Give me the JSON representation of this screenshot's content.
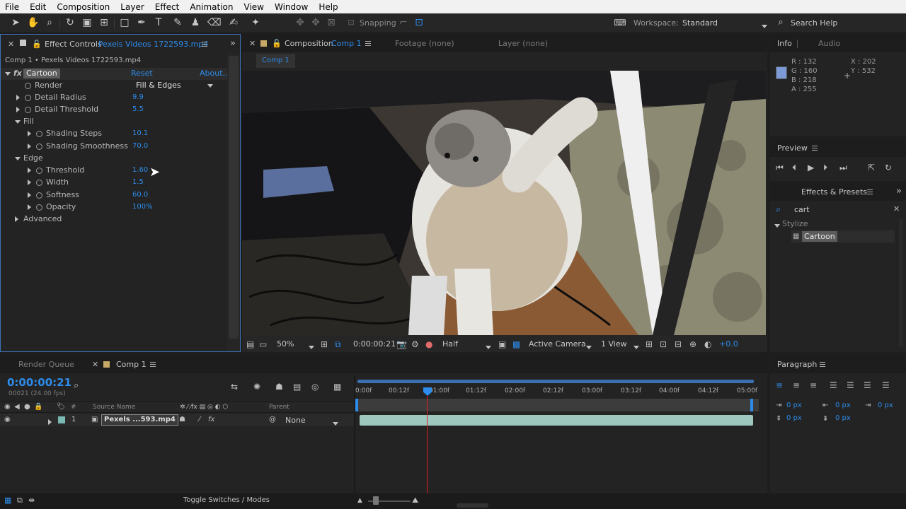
{
  "menu": [
    "File",
    "Edit",
    "Composition",
    "Layer",
    "Effect",
    "Animation",
    "View",
    "Window",
    "Help"
  ],
  "toolbar": {
    "snapping": "Snapping",
    "workspace_label": "Workspace:",
    "workspace_value": "Standard",
    "search_help": "Search Help"
  },
  "effect_controls": {
    "tab_label": "Effect Controls",
    "tab_file": "Pexels Videos 1722593.mp4",
    "header": "Comp 1 • Pexels Videos 1722593.mp4",
    "effect_name": "Cartoon",
    "reset": "Reset",
    "about": "About...",
    "render": {
      "label": "Render",
      "value": "Fill & Edges"
    },
    "detail_radius": {
      "label": "Detail Radius",
      "value": "9.9"
    },
    "detail_threshold": {
      "label": "Detail Threshold",
      "value": "5.5"
    },
    "fill": {
      "label": "Fill"
    },
    "shading_steps": {
      "label": "Shading Steps",
      "value": "10.1"
    },
    "shading_smoothness": {
      "label": "Shading Smoothness",
      "value": "70.0"
    },
    "edge": {
      "label": "Edge"
    },
    "threshold": {
      "label": "Threshold",
      "value": "1.60"
    },
    "width": {
      "label": "Width",
      "value": "1.5"
    },
    "softness": {
      "label": "Softness",
      "value": "60.0"
    },
    "opacity": {
      "label": "Opacity",
      "value": "100%"
    },
    "advanced": {
      "label": "Advanced"
    }
  },
  "composition": {
    "tab_label": "Composition",
    "tab_comp": "Comp 1",
    "footage": "Footage (none)",
    "layer": "Layer (none)",
    "crumb": "Comp 1",
    "zoom": "50%",
    "timecode": "0:00:00:21",
    "resolution": "Half",
    "camera": "Active Camera",
    "views": "1 View",
    "exposure": "+0.0"
  },
  "info": {
    "tab": "Info",
    "audio": "Audio",
    "r": "R : 132",
    "g": "G : 160",
    "b": "B : 218",
    "a": "A : 255",
    "x": "X : 202",
    "y": "Y : 532",
    "swatch": "#7b9ad6"
  },
  "preview": {
    "tab": "Preview"
  },
  "effects_presets": {
    "tab": "Effects & Presets",
    "search": "cart",
    "category": "Stylize",
    "item": "Cartoon"
  },
  "timeline": {
    "render_queue": "Render Queue",
    "comp_tab": "Comp 1",
    "timecode": "0:00:00:21",
    "fps": "00021 (24.00 fps)",
    "col_num": "#",
    "col_source": "Source Name",
    "col_parent": "Parent",
    "ruler": [
      "0:00f",
      "00:12f",
      "01:00f",
      "01:12f",
      "02:00f",
      "02:12f",
      "03:00f",
      "03:12f",
      "04:00f",
      "04:12f",
      "05:00f"
    ],
    "layer": {
      "num": "1",
      "name": "Pexels ...593.mp4",
      "parent": "None"
    },
    "toggle": "Toggle Switches / Modes"
  },
  "paragraph": {
    "tab": "Paragraph",
    "px1": "0 px",
    "px2": "0 px",
    "px3": "0 px",
    "px4": "0 px",
    "px5": "0 px"
  }
}
